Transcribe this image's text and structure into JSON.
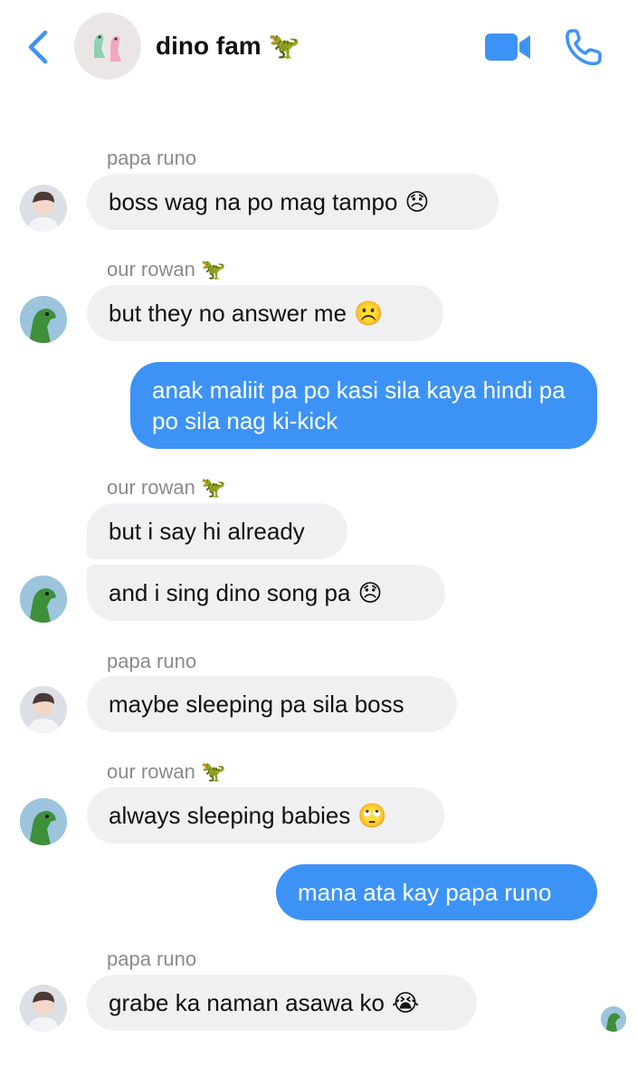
{
  "header": {
    "title": "dino fam",
    "title_emoji": "🦖",
    "accent": "#3d93f5"
  },
  "messages": [
    {
      "sender": "papa runo",
      "sender_emoji": "",
      "text": "boss wag na po mag tampo",
      "emoji": "😞",
      "direction": "in",
      "avatar": "person"
    },
    {
      "sender": "our rowan",
      "sender_emoji": "🦖",
      "text": "but they no answer me",
      "emoji": "☹️",
      "direction": "in",
      "avatar": "dino"
    },
    {
      "sender": "",
      "text": "anak maliit pa po kasi sila kaya hindi pa po sila nag ki-kick",
      "direction": "out"
    },
    {
      "sender": "our rowan",
      "sender_emoji": "🦖",
      "text": "but i say hi already",
      "direction": "in"
    },
    {
      "sender": "",
      "text": "and i sing dino song pa",
      "emoji": "😞",
      "direction": "in",
      "avatar": "dino"
    },
    {
      "sender": "papa runo",
      "sender_emoji": "",
      "text": "maybe sleeping pa sila boss",
      "direction": "in",
      "avatar": "person"
    },
    {
      "sender": "our rowan",
      "sender_emoji": "🦖",
      "text": "always sleeping babies",
      "emoji": "🙄",
      "direction": "in",
      "avatar": "dino"
    },
    {
      "sender": "",
      "text": "mana ata kay papa runo",
      "direction": "out"
    },
    {
      "sender": "papa runo",
      "sender_emoji": "",
      "text": "grabe ka naman asawa ko",
      "emoji": "😭",
      "direction": "in",
      "avatar": "person"
    }
  ],
  "icons": {
    "back": "chevron-left-icon",
    "video": "video-camera-icon",
    "call": "phone-icon"
  }
}
